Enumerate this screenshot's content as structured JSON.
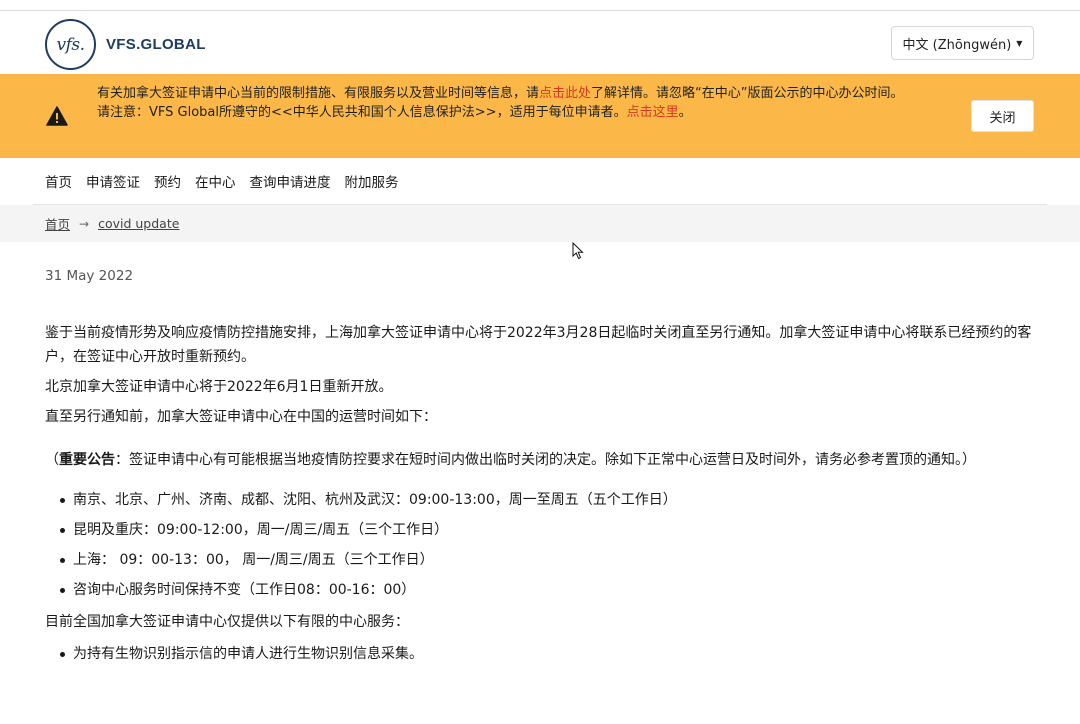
{
  "header": {
    "logo_mark": "vfs.",
    "logo_text": "VFS.GLOBAL",
    "language": "中文 (Zhōngwén)"
  },
  "banner": {
    "line1_pre": "有关加拿大签证申请中心当前的限制措施、有限服务以及营业时间等信息，请",
    "line1_link": "点击此处",
    "line1_post": "了解详情。请忽略“在中心”版面公示的中心办公时间。",
    "line2_pre": "请注意：VFS Global所遵守的<<中华人民共和国个人信息保护法>>，适用于每位申请者。",
    "line2_link": "点击这里",
    "line2_post": "。",
    "close_label": "关闭",
    "accent_color": "#fbb849",
    "link_color": "#d83a1f"
  },
  "nav": {
    "items": [
      "首页",
      "申请签证",
      "预约",
      "在中心",
      "查询申请进度",
      "附加服务"
    ]
  },
  "breadcrumb": {
    "home": "首页",
    "current": "covid update"
  },
  "article": {
    "date": "31 May 2022",
    "p1": "鉴于当前疫情形势及响应疫情防控措施安排，上海加拿大签证申请中心将于2022年3月28日起临时关闭直至另行通知。加拿大签证申请中心将联系已经预约的客户，在签证中心开放时重新预约。",
    "p2": "北京加拿大签证申请中心将于2022年6月1日重新开放。",
    "p3": "直至另行通知前，加拿大签证申请中心在中国的运营时间如下：",
    "notice_open": "（",
    "notice_bold": "重要公告",
    "notice_text": "：签证申请中心有可能根据当地疫情防控要求在短时间内做出临时关闭的决定。除如下正常中心运营日及时间外，请务必参考置顶的通知。）",
    "hours": [
      "南京、北京、广州、济南、成都、沈阳、杭州及武汉：09:00-13:00，周一至周五（五个工作日）",
      "昆明及重庆：09:00-12:00，周一/周三/周五（三个工作日）",
      "上海： 09：00-13：00， 周一/周三/周五（三个工作日）",
      "咨询中心服务时间保持不变（工作日08：00-16：00）"
    ],
    "p4": "目前全国加拿大签证申请中心仅提供以下有限的中心服务：",
    "services": [
      "为持有生物识别指示信的申请人进行生物识别信息采集。"
    ]
  }
}
